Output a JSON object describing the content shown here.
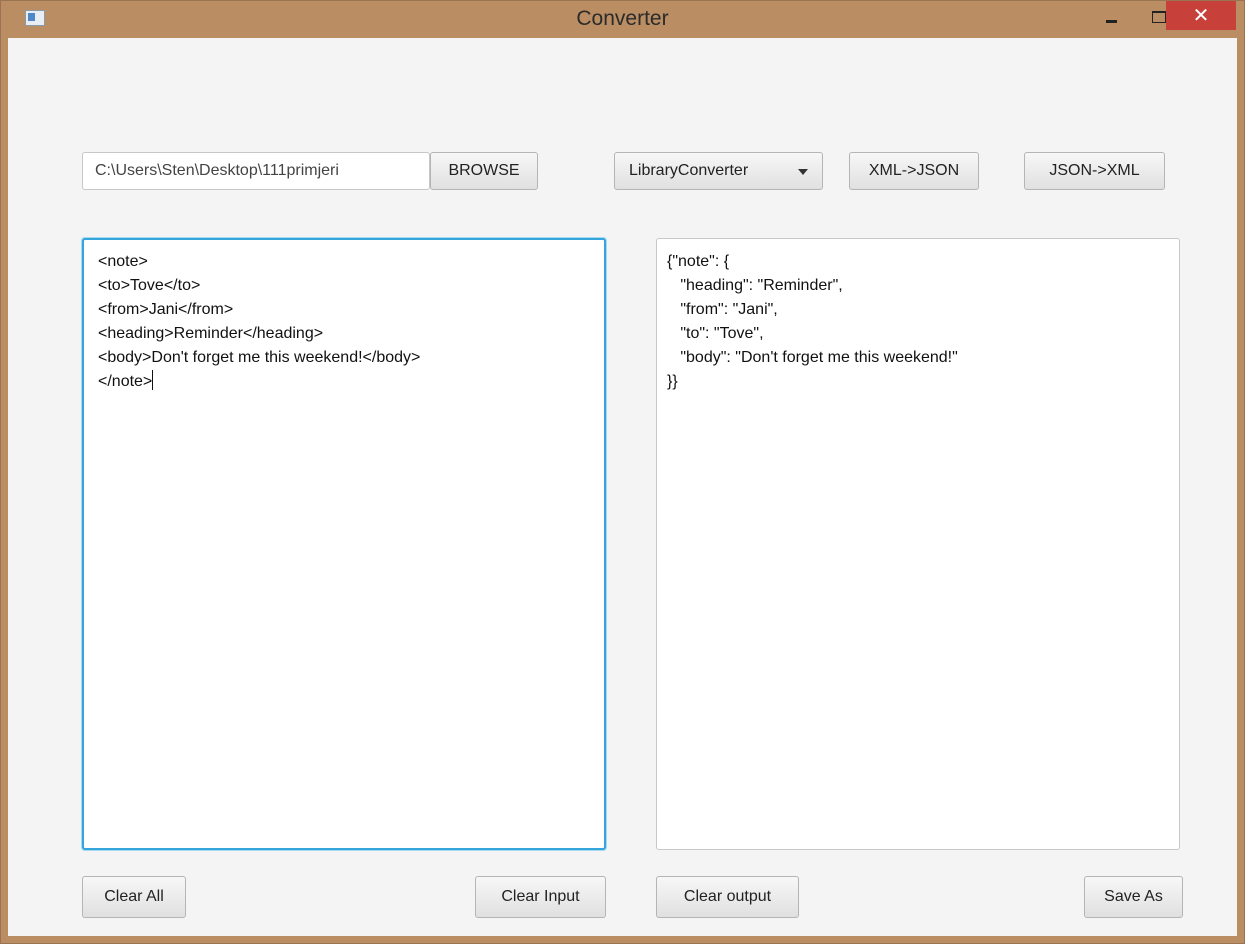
{
  "window": {
    "title": "Converter",
    "minimize_label": "–",
    "close_label": "✕"
  },
  "toolbar": {
    "path_value": "C:\\Users\\Sten\\Desktop\\111primjeri",
    "browse_label": "BROWSE",
    "converter_selected": "LibraryConverter",
    "xml_to_json_label": "XML->JSON",
    "json_to_xml_label": "JSON->XML"
  },
  "input": {
    "lines": [
      "<note>",
      "<to>Tove</to>",
      "<from>Jani</from>",
      "<heading>Reminder</heading>",
      "<body>Don't forget me this weekend!</body>",
      "</note>"
    ]
  },
  "output": {
    "lines": [
      "{\"note\": {",
      "   \"heading\": \"Reminder\",",
      "   \"from\": \"Jani\",",
      "   \"to\": \"Tove\",",
      "   \"body\": \"Don't forget me this weekend!\"",
      "}}"
    ]
  },
  "footer": {
    "clear_all_label": "Clear All",
    "clear_input_label": "Clear Input",
    "clear_output_label": "Clear output",
    "save_as_label": "Save As"
  }
}
